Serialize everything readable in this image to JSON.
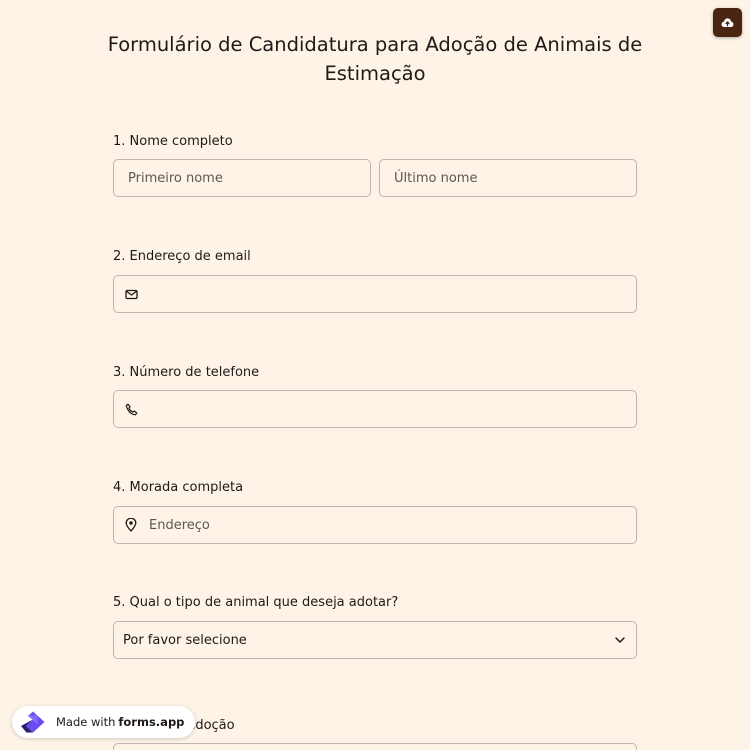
{
  "form": {
    "title": "Formulário de Candidatura para Adoção de Animais de Estimação"
  },
  "questions": [
    {
      "label": "1. Nome completo",
      "first_placeholder": "Primeiro nome",
      "last_placeholder": "Último nome"
    },
    {
      "label": "2. Endereço de email",
      "icon": "mail-icon"
    },
    {
      "label": "3. Número de telefone",
      "icon": "phone-icon"
    },
    {
      "label": "4. Morada completa",
      "icon": "location-pin-icon",
      "placeholder": "Endereço"
    },
    {
      "label": "5. Qual o tipo de animal que deseja adotar?",
      "selected": "Por favor selecione"
    },
    {
      "label": "da adoção"
    }
  ],
  "badge": {
    "made_with": "Made with",
    "brand": "forms.app"
  },
  "toolbar": {
    "save_icon": "cloud-upload-icon"
  },
  "colors": {
    "background": "#fdf3e7",
    "save_button": "#4a2512",
    "border": "#bdb6ae",
    "logo": "#6c4cf0"
  }
}
